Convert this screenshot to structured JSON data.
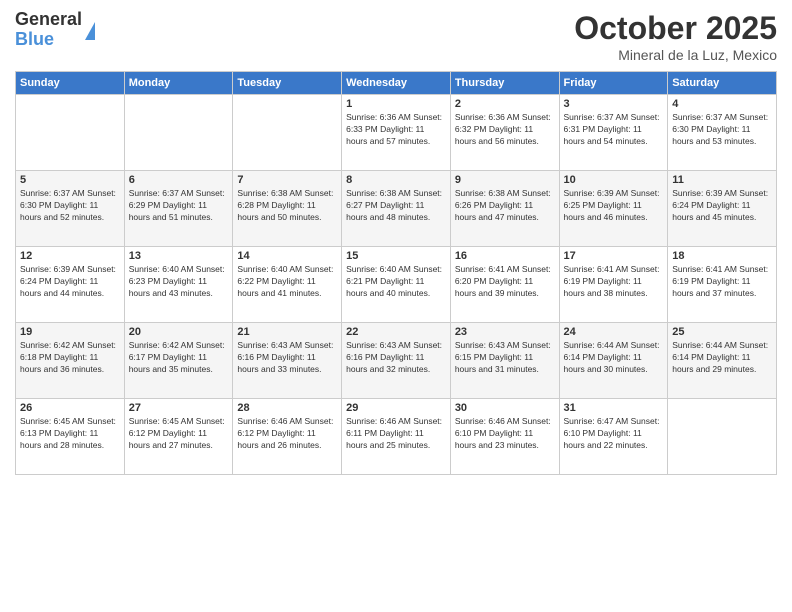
{
  "logo": {
    "general": "General",
    "blue": "Blue"
  },
  "header": {
    "month": "October 2025",
    "location": "Mineral de la Luz, Mexico"
  },
  "days_of_week": [
    "Sunday",
    "Monday",
    "Tuesday",
    "Wednesday",
    "Thursday",
    "Friday",
    "Saturday"
  ],
  "weeks": [
    [
      {
        "day": "",
        "info": ""
      },
      {
        "day": "",
        "info": ""
      },
      {
        "day": "",
        "info": ""
      },
      {
        "day": "1",
        "info": "Sunrise: 6:36 AM\nSunset: 6:33 PM\nDaylight: 11 hours and 57 minutes."
      },
      {
        "day": "2",
        "info": "Sunrise: 6:36 AM\nSunset: 6:32 PM\nDaylight: 11 hours and 56 minutes."
      },
      {
        "day": "3",
        "info": "Sunrise: 6:37 AM\nSunset: 6:31 PM\nDaylight: 11 hours and 54 minutes."
      },
      {
        "day": "4",
        "info": "Sunrise: 6:37 AM\nSunset: 6:30 PM\nDaylight: 11 hours and 53 minutes."
      }
    ],
    [
      {
        "day": "5",
        "info": "Sunrise: 6:37 AM\nSunset: 6:30 PM\nDaylight: 11 hours and 52 minutes."
      },
      {
        "day": "6",
        "info": "Sunrise: 6:37 AM\nSunset: 6:29 PM\nDaylight: 11 hours and 51 minutes."
      },
      {
        "day": "7",
        "info": "Sunrise: 6:38 AM\nSunset: 6:28 PM\nDaylight: 11 hours and 50 minutes."
      },
      {
        "day": "8",
        "info": "Sunrise: 6:38 AM\nSunset: 6:27 PM\nDaylight: 11 hours and 48 minutes."
      },
      {
        "day": "9",
        "info": "Sunrise: 6:38 AM\nSunset: 6:26 PM\nDaylight: 11 hours and 47 minutes."
      },
      {
        "day": "10",
        "info": "Sunrise: 6:39 AM\nSunset: 6:25 PM\nDaylight: 11 hours and 46 minutes."
      },
      {
        "day": "11",
        "info": "Sunrise: 6:39 AM\nSunset: 6:24 PM\nDaylight: 11 hours and 45 minutes."
      }
    ],
    [
      {
        "day": "12",
        "info": "Sunrise: 6:39 AM\nSunset: 6:24 PM\nDaylight: 11 hours and 44 minutes."
      },
      {
        "day": "13",
        "info": "Sunrise: 6:40 AM\nSunset: 6:23 PM\nDaylight: 11 hours and 43 minutes."
      },
      {
        "day": "14",
        "info": "Sunrise: 6:40 AM\nSunset: 6:22 PM\nDaylight: 11 hours and 41 minutes."
      },
      {
        "day": "15",
        "info": "Sunrise: 6:40 AM\nSunset: 6:21 PM\nDaylight: 11 hours and 40 minutes."
      },
      {
        "day": "16",
        "info": "Sunrise: 6:41 AM\nSunset: 6:20 PM\nDaylight: 11 hours and 39 minutes."
      },
      {
        "day": "17",
        "info": "Sunrise: 6:41 AM\nSunset: 6:19 PM\nDaylight: 11 hours and 38 minutes."
      },
      {
        "day": "18",
        "info": "Sunrise: 6:41 AM\nSunset: 6:19 PM\nDaylight: 11 hours and 37 minutes."
      }
    ],
    [
      {
        "day": "19",
        "info": "Sunrise: 6:42 AM\nSunset: 6:18 PM\nDaylight: 11 hours and 36 minutes."
      },
      {
        "day": "20",
        "info": "Sunrise: 6:42 AM\nSunset: 6:17 PM\nDaylight: 11 hours and 35 minutes."
      },
      {
        "day": "21",
        "info": "Sunrise: 6:43 AM\nSunset: 6:16 PM\nDaylight: 11 hours and 33 minutes."
      },
      {
        "day": "22",
        "info": "Sunrise: 6:43 AM\nSunset: 6:16 PM\nDaylight: 11 hours and 32 minutes."
      },
      {
        "day": "23",
        "info": "Sunrise: 6:43 AM\nSunset: 6:15 PM\nDaylight: 11 hours and 31 minutes."
      },
      {
        "day": "24",
        "info": "Sunrise: 6:44 AM\nSunset: 6:14 PM\nDaylight: 11 hours and 30 minutes."
      },
      {
        "day": "25",
        "info": "Sunrise: 6:44 AM\nSunset: 6:14 PM\nDaylight: 11 hours and 29 minutes."
      }
    ],
    [
      {
        "day": "26",
        "info": "Sunrise: 6:45 AM\nSunset: 6:13 PM\nDaylight: 11 hours and 28 minutes."
      },
      {
        "day": "27",
        "info": "Sunrise: 6:45 AM\nSunset: 6:12 PM\nDaylight: 11 hours and 27 minutes."
      },
      {
        "day": "28",
        "info": "Sunrise: 6:46 AM\nSunset: 6:12 PM\nDaylight: 11 hours and 26 minutes."
      },
      {
        "day": "29",
        "info": "Sunrise: 6:46 AM\nSunset: 6:11 PM\nDaylight: 11 hours and 25 minutes."
      },
      {
        "day": "30",
        "info": "Sunrise: 6:46 AM\nSunset: 6:10 PM\nDaylight: 11 hours and 23 minutes."
      },
      {
        "day": "31",
        "info": "Sunrise: 6:47 AM\nSunset: 6:10 PM\nDaylight: 11 hours and 22 minutes."
      },
      {
        "day": "",
        "info": ""
      }
    ]
  ]
}
